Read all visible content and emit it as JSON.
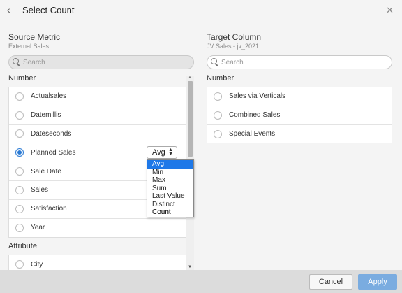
{
  "header": {
    "title": "Select Count",
    "back_icon": "chevron-left-icon",
    "close_icon": "close-icon"
  },
  "source": {
    "title": "Source Metric",
    "subtitle": "External Sales",
    "search_placeholder": "Search",
    "number_section": "Number",
    "attribute_section": "Attribute",
    "number_items": [
      "Actualsales",
      "Datemillis",
      "Dateseconds",
      "Planned Sales",
      "Sale Date",
      "Sales",
      "Satisfaction",
      "Year"
    ],
    "selected_item": "Planned Sales",
    "attribute_items": [
      "City"
    ]
  },
  "target": {
    "title": "Target Column",
    "subtitle": "JV Sales - jv_2021",
    "search_placeholder": "Search",
    "number_section": "Number",
    "number_items": [
      "Sales via Verticals",
      "Combined Sales",
      "Special Events"
    ]
  },
  "aggregation": {
    "selected": "Avg",
    "options": [
      "Avg",
      "Min",
      "Max",
      "Sum",
      "Last Value",
      "Distinct Count",
      "Count"
    ]
  },
  "footer": {
    "cancel_label": "Cancel",
    "apply_label": "Apply"
  },
  "colors": {
    "accent": "#2a7ad4",
    "dropdown_highlight": "#1e78e8",
    "apply_button": "#7aace0",
    "footer_bg": "#dcdcdc"
  }
}
